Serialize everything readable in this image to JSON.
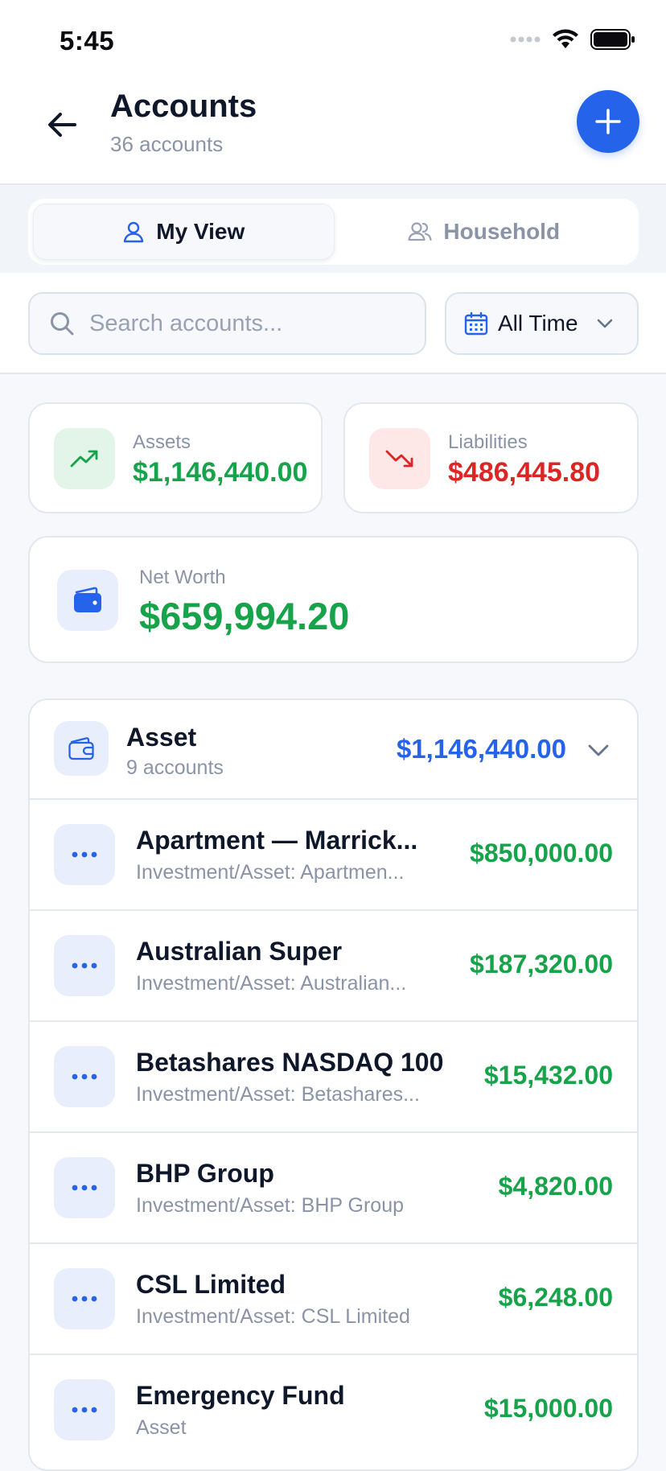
{
  "status_bar": {
    "time": "5:45"
  },
  "header": {
    "title": "Accounts",
    "subtitle": "36 accounts"
  },
  "tabs": [
    {
      "label": "My View",
      "active": true
    },
    {
      "label": "Household",
      "active": false
    }
  ],
  "search": {
    "placeholder": "Search accounts...",
    "value": ""
  },
  "date_filter": {
    "selected": "All Time"
  },
  "summary": {
    "assets": {
      "label": "Assets",
      "value": "$1,146,440.00"
    },
    "liabilities": {
      "label": "Liabilities",
      "value": "$486,445.80"
    },
    "net_worth": {
      "label": "Net Worth",
      "value": "$659,994.20"
    }
  },
  "group": {
    "name": "Asset",
    "count": "9 accounts",
    "total": "$1,146,440.00",
    "accounts": [
      {
        "name": "Apartment — Marrick...",
        "subtitle": "Investment/Asset: Apartmen...",
        "amount": "$850,000.00"
      },
      {
        "name": "Australian Super",
        "subtitle": "Investment/Asset: Australian...",
        "amount": "$187,320.00"
      },
      {
        "name": "Betashares NASDAQ 100",
        "subtitle": "Investment/Asset: Betashares...",
        "amount": "$15,432.00"
      },
      {
        "name": "BHP Group",
        "subtitle": "Investment/Asset: BHP Group",
        "amount": "$4,820.00"
      },
      {
        "name": "CSL Limited",
        "subtitle": "Investment/Asset: CSL Limited",
        "amount": "$6,248.00"
      },
      {
        "name": "Emergency Fund",
        "subtitle": "Asset",
        "amount": "$15,000.00"
      }
    ]
  },
  "colors": {
    "accent": "#2563eb",
    "positive": "#16a34a",
    "negative": "#dc2626",
    "muted": "#8a94a6"
  }
}
